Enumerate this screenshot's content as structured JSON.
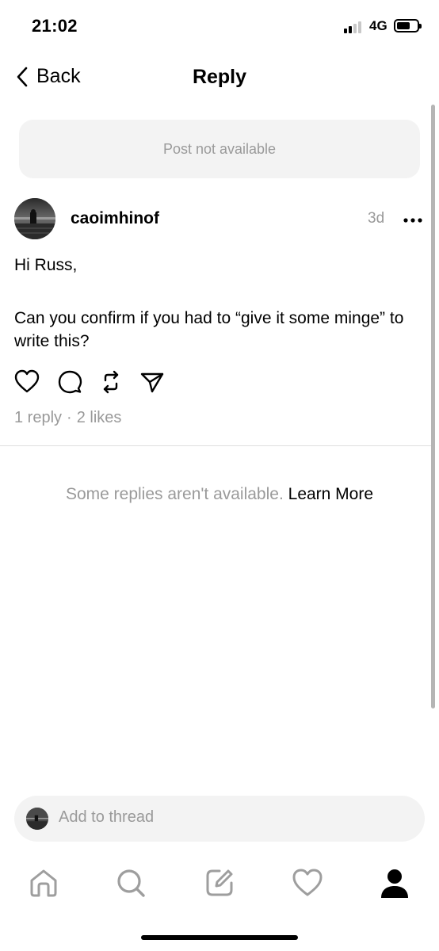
{
  "status_bar": {
    "time": "21:02",
    "network": "4G"
  },
  "header": {
    "back_label": "Back",
    "title": "Reply"
  },
  "parent_post": {
    "unavailable_text": "Post not available"
  },
  "post": {
    "username": "caoimhinof",
    "timestamp": "3d",
    "body_lines": [
      "Hi Russ,",
      "Can you confirm if you had to “give it some minge” to write this?"
    ],
    "reply_count": "1 reply",
    "separator": "·",
    "likes_count": "2 likes"
  },
  "replies_note": {
    "text": "Some replies aren't available.",
    "link": "Learn More"
  },
  "composer": {
    "placeholder": "Add to thread"
  },
  "icons": {
    "actions": [
      "heart-icon",
      "comment-icon",
      "repost-icon",
      "share-icon"
    ],
    "tabs": [
      "home-icon",
      "search-icon",
      "compose-icon",
      "activity-icon",
      "profile-icon"
    ]
  }
}
